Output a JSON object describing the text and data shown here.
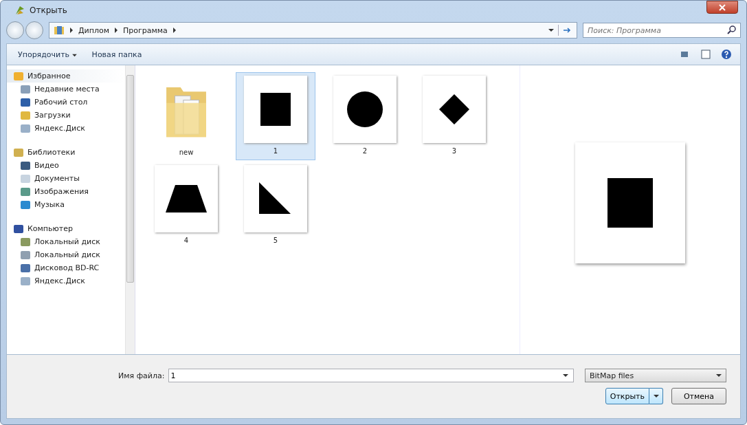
{
  "window": {
    "title": "Открыть"
  },
  "address": {
    "path": [
      "Диплом",
      "Программа"
    ]
  },
  "search": {
    "placeholder": "Поиск: Программа"
  },
  "toolbar": {
    "organize": "Упорядочить",
    "new_folder": "Новая папка"
  },
  "sidebar": {
    "groups": [
      {
        "label": "Избранное",
        "kind": "favorites",
        "selected": true,
        "items": [
          {
            "label": "Недавние места",
            "kind": "recent"
          },
          {
            "label": "Рабочий стол",
            "kind": "desktop"
          },
          {
            "label": "Загрузки",
            "kind": "downloads"
          },
          {
            "label": "Яндекс.Диск",
            "kind": "cloud"
          }
        ]
      },
      {
        "label": "Библиотеки",
        "kind": "libraries",
        "selected": false,
        "items": [
          {
            "label": "Видео",
            "kind": "video"
          },
          {
            "label": "Документы",
            "kind": "docs"
          },
          {
            "label": "Изображения",
            "kind": "pictures"
          },
          {
            "label": "Музыка",
            "kind": "music"
          }
        ]
      },
      {
        "label": "Компьютер",
        "kind": "computer",
        "selected": false,
        "items": [
          {
            "label": "Локальный диск",
            "kind": "disk"
          },
          {
            "label": "Локальный диск",
            "kind": "drive"
          },
          {
            "label": "Дисковод BD-RC",
            "kind": "optical"
          },
          {
            "label": "Яндекс.Диск",
            "kind": "cloud"
          }
        ]
      }
    ]
  },
  "files": [
    {
      "name": "new",
      "kind": "folder",
      "selected": false
    },
    {
      "name": "1",
      "kind": "square",
      "selected": true
    },
    {
      "name": "2",
      "kind": "circle",
      "selected": false
    },
    {
      "name": "3",
      "kind": "diamond",
      "selected": false
    },
    {
      "name": "4",
      "kind": "trapezoid",
      "selected": false
    },
    {
      "name": "5",
      "kind": "triangle",
      "selected": false
    }
  ],
  "filename": {
    "label": "Имя файла:",
    "value": "1"
  },
  "filter": {
    "value": "BitMap files"
  },
  "buttons": {
    "open": "Открыть",
    "cancel": "Отмена"
  }
}
